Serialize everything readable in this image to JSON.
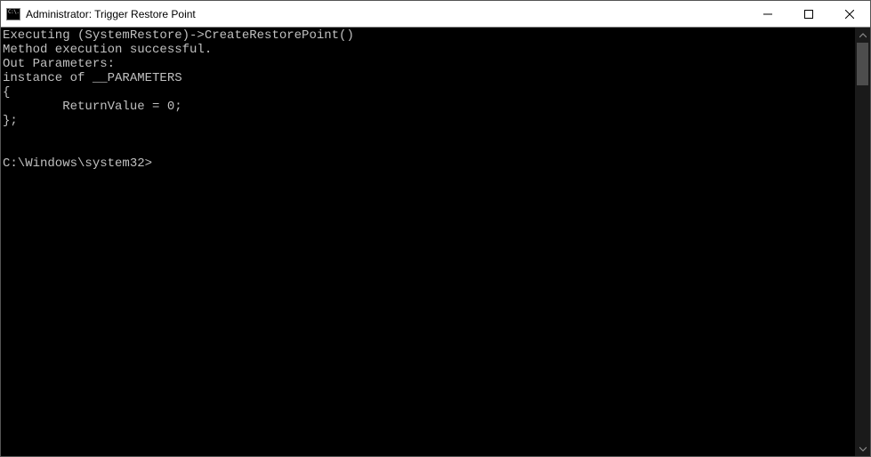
{
  "window": {
    "title": "Administrator: Trigger Restore Point",
    "icon_text": "C:\\."
  },
  "console": {
    "lines": [
      "Executing (SystemRestore)->CreateRestorePoint()",
      "Method execution successful.",
      "Out Parameters:",
      "instance of __PARAMETERS",
      "{",
      "        ReturnValue = 0;",
      "};",
      "",
      ""
    ],
    "prompt": "C:\\Windows\\system32>"
  }
}
